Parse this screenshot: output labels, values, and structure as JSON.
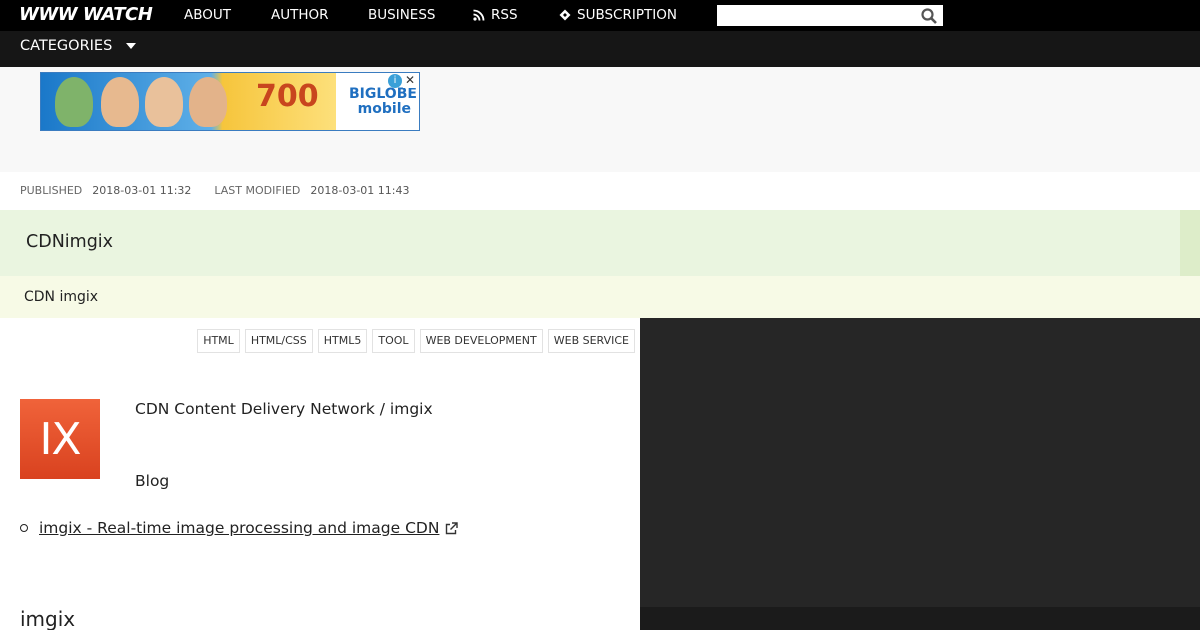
{
  "header": {
    "logo": "WWW WATCH",
    "nav": [
      {
        "label": "ABOUT",
        "icon": ""
      },
      {
        "label": "AUTHOR",
        "icon": ""
      },
      {
        "label": "BUSINESS",
        "icon": ""
      },
      {
        "label": "RSS",
        "icon": "rss-icon"
      },
      {
        "label": "SUBSCRIPTION",
        "icon": "feedly-icon"
      }
    ],
    "search": {
      "placeholder": "",
      "value": "",
      "icon": "search-icon"
    }
  },
  "categories": {
    "label": "CATEGORIES",
    "icon": "caret-down-icon"
  },
  "ad": {
    "headline": "700",
    "brand": "BIGLOBE mobile",
    "close": "✕",
    "info": "i"
  },
  "meta": {
    "published_label": "PUBLISHED",
    "published": "2018-03-01 11:32",
    "modified_label": "LAST MODIFIED",
    "modified": "2018-03-01 11:43"
  },
  "article": {
    "title": "CDNimgix",
    "subtitle": "CDN  imgix",
    "tags": [
      "HTML",
      "HTML/CSS",
      "HTML5",
      "TOOL",
      "WEB DEVELOPMENT",
      "WEB SERVICE"
    ],
    "logo_text": "IX",
    "intro": "CDN Content Delivery Network /   imgix",
    "blog_label": "Blog",
    "links": [
      {
        "text": "imgix - Real-time image processing and image CDN",
        "icon": "external-link-icon"
      }
    ],
    "section_heading": "imgix"
  },
  "colors": {
    "topbar": "#000000",
    "catbar": "#161616",
    "title_band": "#eaf5e0",
    "sub_band": "#f7fae6",
    "sidebar": "#262626",
    "imgix_logo": "#e5522a"
  }
}
